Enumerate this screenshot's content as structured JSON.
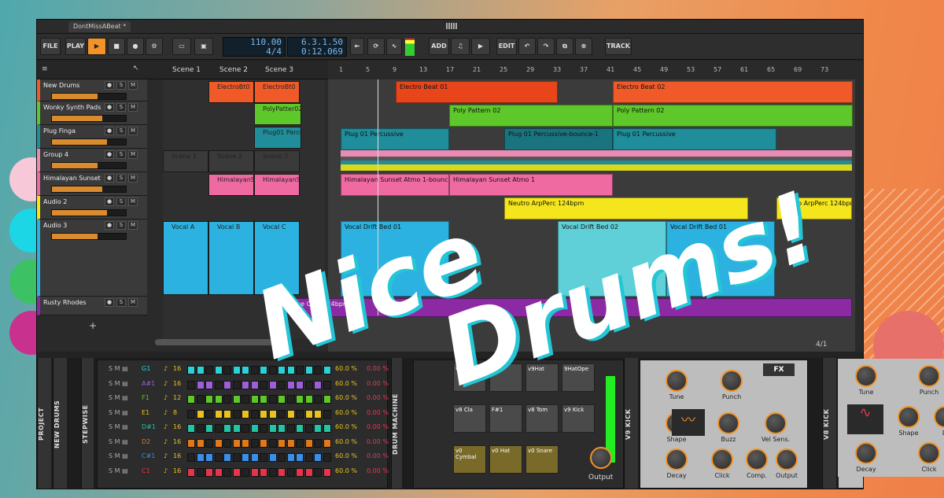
{
  "window": {
    "tab_title": "DontMissABeat *"
  },
  "toolbar": {
    "file": "FILE",
    "play": "PLAY",
    "tempo": "110.00",
    "time_sig": "4/4",
    "position": "6.3.1.50",
    "time": "0:12.069",
    "add": "ADD",
    "edit": "EDIT",
    "track": "TRACK"
  },
  "scenes": [
    "Scene 1",
    "Scene 2",
    "Scene 3"
  ],
  "ruler": [
    "1",
    "5",
    "9",
    "13",
    "17",
    "21",
    "25",
    "29",
    "33",
    "37",
    "41",
    "45",
    "49",
    "53",
    "57",
    "61",
    "65",
    "69",
    "73"
  ],
  "tracks": [
    {
      "name": "New Drums",
      "color": "#f05a28"
    },
    {
      "name": "Wonky Synth Pads",
      "color": "#5ec72a"
    },
    {
      "name": "Plug Finga",
      "color": "#1f8d9a"
    },
    {
      "name": "Group 4",
      "color": "#e98bb3"
    },
    {
      "name": "Himalayan Sunset",
      "color": "#f06aa2"
    },
    {
      "name": "Audio 2",
      "color": "#f5e51c"
    },
    {
      "name": "Audio 3",
      "color": "#2bb2e0"
    },
    {
      "name": "Rusty Rhodes",
      "color": "#8c2aa3"
    }
  ],
  "slots": {
    "new_drums": [
      "ElectroBt0",
      "ElectroBt0"
    ],
    "wonky": [
      "PolyPatter02"
    ],
    "plug": [
      "Plug01 Percu"
    ],
    "group": [
      "Scene 1",
      "Scene 2",
      "Scene 3"
    ],
    "hima": [
      "HimalayanS1",
      "HimalayanS1"
    ],
    "audio3": [
      "Vocal A",
      "Vocal B",
      "Vocal C"
    ]
  },
  "clips": {
    "electro1": "Electro Beat 01",
    "electro2": "Electro Beat 02",
    "poly1": "Poly Pattern 02",
    "poly2": "Poly Pattern 02",
    "plug1": "Plug 01 Percussive",
    "plug2": "Plug 01 Percussive-bounce-1",
    "plug3": "Plug 01 Percussive",
    "hima1": "Himalayan Sunset Atmo 1-bounce-1",
    "hima2": "Himalayan Sunset Atmo 1",
    "neutro1": "Neutro ArpPerc 124bpm",
    "neutro2": "Neutro ArpPerc 124bpm",
    "vocal1": "Vocal Drift Bed 01",
    "vocal2": "Vocal Drift Bed 02",
    "vocal3": "Vocal Drift Bed 01",
    "rusty": "se Ch... 124bpm"
  },
  "zoom": "4/1",
  "device_tabs": {
    "project": "PROJECT",
    "new_drums": "NEW DRUMS",
    "stepwise": "STEPWISE",
    "drum_machine": "DRUM MACHINE",
    "v9kick": "V9 KICK",
    "v8kick": "V8 KICK"
  },
  "steps": [
    {
      "note": "G1",
      "vel": "16",
      "pct1": "60.0 %",
      "pct2": "0.00 %",
      "color": "#2bd1d4"
    },
    {
      "note": "A#1",
      "vel": "16",
      "pct1": "60.0 %",
      "pct2": "0.00 %",
      "color": "#9b5fd6"
    },
    {
      "note": "F1",
      "vel": "12",
      "pct1": "60.0 %",
      "pct2": "0.00 %",
      "color": "#5ec72a"
    },
    {
      "note": "E1",
      "vel": "8",
      "pct1": "60.0 %",
      "pct2": "0.00 %",
      "color": "#e8c21e"
    },
    {
      "note": "D#1",
      "vel": "16",
      "pct1": "60.0 %",
      "pct2": "0.00 %",
      "color": "#22c4a4"
    },
    {
      "note": "D2",
      "vel": "16",
      "pct1": "60.0 %",
      "pct2": "0.00 %",
      "color": "#e0781c"
    },
    {
      "note": "C#1",
      "vel": "16",
      "pct1": "60.0 %",
      "pct2": "0.00 %",
      "color": "#3b8ee8"
    },
    {
      "note": "C1",
      "vel": "16",
      "pct1": "60.0 %",
      "pct2": "0.00 %",
      "color": "#e8344a"
    }
  ],
  "pads": [
    "v9 Rid",
    "#2",
    "v9Hat",
    "9HatOpe",
    "v8 Cla",
    "F#1",
    "v8 Tom",
    "v9 Kick",
    "v0 Cymbal",
    "v0 Hat",
    "v0 Snare"
  ],
  "drum_output": "Output",
  "v9kick": {
    "fx": "FX",
    "knobs": [
      "Tune",
      "Punch",
      "Shape",
      "Buzz",
      "Vel Sens.",
      "Decay",
      "Click",
      "Comp.",
      "Output"
    ]
  },
  "v8kick": {
    "knobs": [
      "Tune",
      "Punch",
      "Shape",
      "Decay",
      "Click",
      "D"
    ]
  },
  "overlay": {
    "line1": "Nice",
    "line2": "Drums!"
  }
}
